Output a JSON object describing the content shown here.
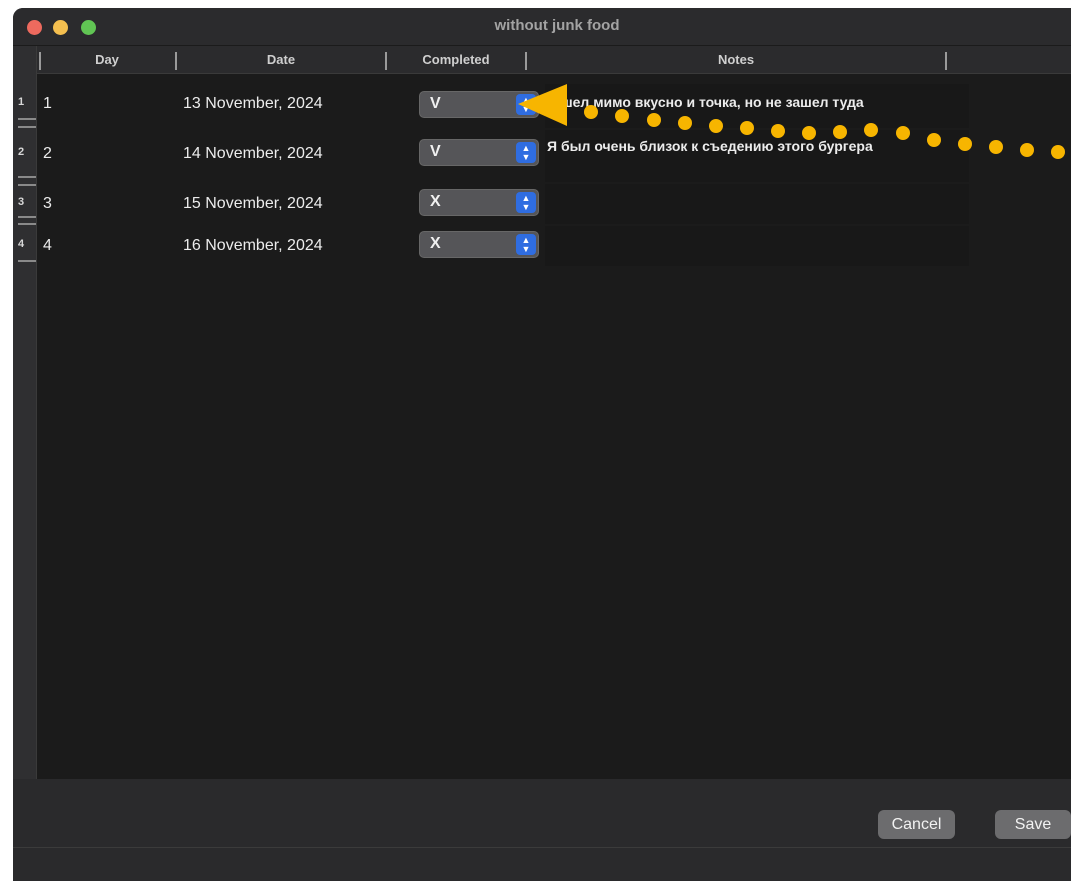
{
  "window": {
    "title": "without junk food"
  },
  "table": {
    "headers": {
      "day": "Day",
      "date": "Date",
      "completed": "Completed",
      "notes": "Notes"
    },
    "rows": [
      {
        "index": "1",
        "day": "1",
        "date": "13 November, 2024",
        "completed": "V",
        "notes": "Я шел мимо вкусно и точка, но не зашел туда"
      },
      {
        "index": "2",
        "day": "2",
        "date": "14 November, 2024",
        "completed": "V",
        "notes": "Я был очень близок к съедению этого бургера"
      },
      {
        "index": "3",
        "day": "3",
        "date": "15 November, 2024",
        "completed": "X",
        "notes": ""
      },
      {
        "index": "4",
        "day": "4",
        "date": "16 November, 2024",
        "completed": "X",
        "notes": ""
      }
    ]
  },
  "footer": {
    "cancel_label": "Cancel",
    "save_label": "Save"
  },
  "popup_icon": "chevron-up-down-icon",
  "colors": {
    "accent": "#2f6de1",
    "annotation": "#f7b500"
  }
}
